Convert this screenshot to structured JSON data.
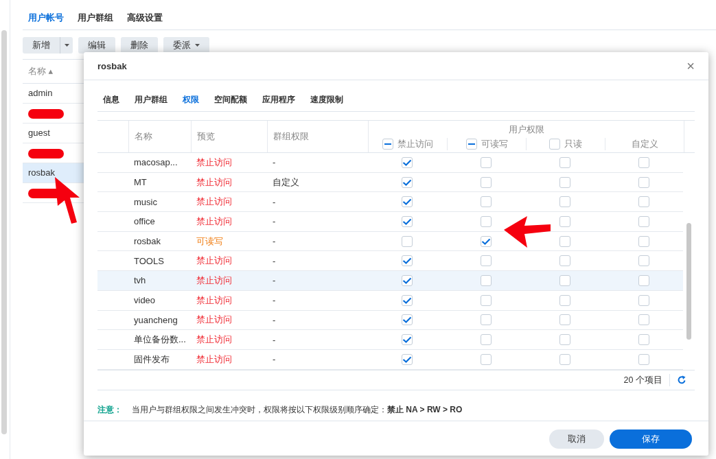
{
  "main_tabs": [
    {
      "label": "用户帐号",
      "selected": true
    },
    {
      "label": "用户群组",
      "selected": false
    },
    {
      "label": "高级设置",
      "selected": false
    }
  ],
  "toolbar": {
    "create": "新增",
    "buttons": [
      {
        "label": "编辑",
        "caret": false
      },
      {
        "label": "删除",
        "caret": false
      },
      {
        "label": "委派",
        "caret": true
      }
    ]
  },
  "user_list": {
    "column": "名称 ▴",
    "rows": [
      {
        "name": "admin",
        "redacted": false,
        "selected": false
      },
      {
        "redacted": true,
        "selected": false
      },
      {
        "name": "guest",
        "redacted": false,
        "selected": false
      },
      {
        "redacted": true,
        "selected": false
      },
      {
        "name": "rosbak",
        "redacted": false,
        "selected": true
      },
      {
        "redacted": true,
        "selected": false
      }
    ]
  },
  "dialog": {
    "title": "rosbak",
    "close": "×",
    "tabs": [
      {
        "label": "信息",
        "selected": false
      },
      {
        "label": "用户群组",
        "selected": false
      },
      {
        "label": "权限",
        "selected": true
      },
      {
        "label": "空间配额",
        "selected": false
      },
      {
        "label": "应用程序",
        "selected": false
      },
      {
        "label": "速度限制",
        "selected": false
      }
    ],
    "table": {
      "columns": [
        "名称",
        "预览",
        "群组权限"
      ],
      "group_header": "用户权限",
      "perm_columns": [
        {
          "label": "禁止访问",
          "partial": true
        },
        {
          "label": "可读写",
          "partial": true
        },
        {
          "label": "只读",
          "partial": false
        },
        {
          "label": "自定义"
        }
      ],
      "rows": [
        {
          "name": "macosap...",
          "preview": "禁止访问",
          "color": "#f0262f",
          "group": "-",
          "hovered": false,
          "perms": [
            true,
            false,
            false,
            false
          ]
        },
        {
          "name": "MT",
          "preview": "禁止访问",
          "color": "#f0262f",
          "group": "自定义",
          "hovered": false,
          "perms": [
            true,
            false,
            false,
            false
          ]
        },
        {
          "name": "music",
          "preview": "禁止访问",
          "color": "#f0262f",
          "group": "-",
          "hovered": false,
          "perms": [
            true,
            false,
            false,
            false
          ]
        },
        {
          "name": "office",
          "preview": "禁止访问",
          "color": "#f0262f",
          "group": "-",
          "hovered": false,
          "perms": [
            true,
            false,
            false,
            false
          ]
        },
        {
          "name": "rosbak",
          "preview": "可读写",
          "color": "#f07c10",
          "group": "-",
          "hovered": false,
          "perms": [
            false,
            true,
            false,
            false
          ]
        },
        {
          "name": "TOOLS",
          "preview": "禁止访问",
          "color": "#f0262f",
          "group": "-",
          "hovered": false,
          "perms": [
            true,
            false,
            false,
            false
          ]
        },
        {
          "name": "tvh",
          "preview": "禁止访问",
          "color": "#f0262f",
          "group": "-",
          "hovered": true,
          "perms": [
            true,
            false,
            false,
            false
          ]
        },
        {
          "name": "video",
          "preview": "禁止访问",
          "color": "#f0262f",
          "group": "-",
          "hovered": false,
          "perms": [
            true,
            false,
            false,
            false
          ]
        },
        {
          "name": "yuancheng",
          "preview": "禁止访问",
          "color": "#f0262f",
          "group": "-",
          "hovered": false,
          "perms": [
            true,
            false,
            false,
            false
          ]
        },
        {
          "name": "单位备份数...",
          "preview": "禁止访问",
          "color": "#f0262f",
          "group": "-",
          "hovered": false,
          "perms": [
            true,
            false,
            false,
            false
          ]
        },
        {
          "name": "固件发布",
          "preview": "禁止访问",
          "color": "#f0262f",
          "group": "-",
          "hovered": false,
          "perms": [
            true,
            false,
            false,
            false
          ]
        }
      ],
      "count": "20 个项目"
    },
    "note_label": "注意：",
    "note": "当用户与群组权限之间发生冲突时，权限将按以下权限级别顺序确定：**禁止 NA > RW > RO**",
    "cancel": "取消",
    "save": "保存"
  }
}
